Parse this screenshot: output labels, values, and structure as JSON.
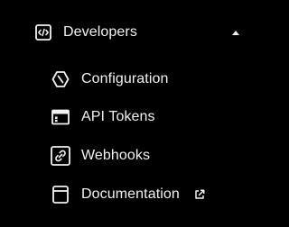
{
  "nav": {
    "section": {
      "label": "Developers",
      "icon": "code-icon",
      "toggle_icon": "caret-up-icon",
      "expanded": true
    },
    "items": [
      {
        "label": "Configuration",
        "icon": "hexagon-config-icon"
      },
      {
        "label": "API Tokens",
        "icon": "api-tokens-window-icon"
      },
      {
        "label": "Webhooks",
        "icon": "link-icon"
      },
      {
        "label": "Documentation",
        "icon": "book-icon",
        "external_icon": "external-link-icon"
      }
    ]
  },
  "colors": {
    "background": "#000000",
    "text": "#f2f2f2"
  }
}
